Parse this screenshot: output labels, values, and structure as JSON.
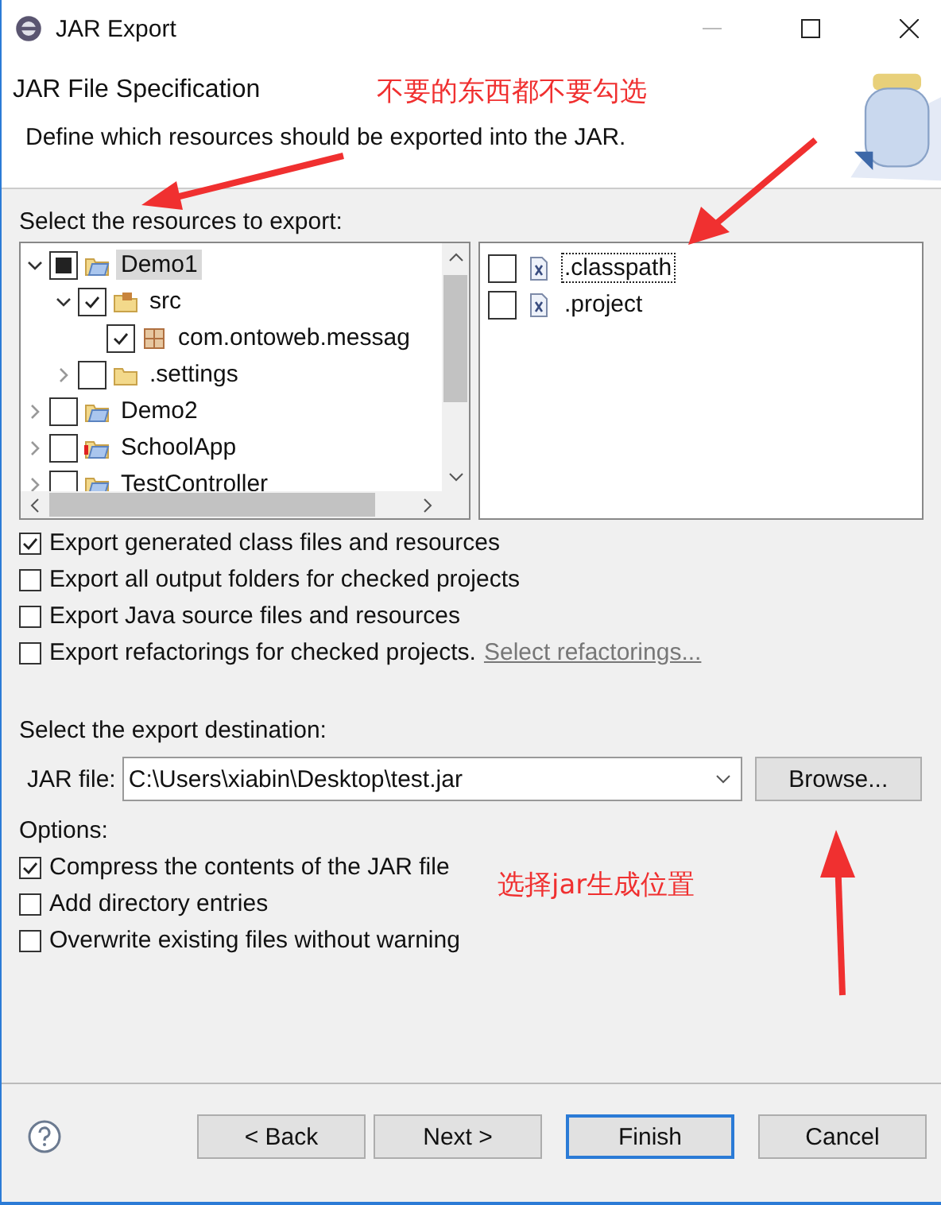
{
  "window": {
    "title": "JAR Export"
  },
  "header": {
    "title": "JAR File Specification",
    "description": "Define which resources should be exported into the JAR."
  },
  "annotations": [
    {
      "text": "不要的东西都不要勾选"
    },
    {
      "text": "选择jar生成位置"
    }
  ],
  "resources": {
    "label": "Select the resources to export:",
    "tree": [
      {
        "label": "Demo1",
        "kind": "project",
        "checked": true,
        "grayed": true,
        "expanded": true,
        "selected": true,
        "children": [
          {
            "label": "src",
            "kind": "source-folder",
            "checked": true,
            "expanded": true,
            "selected": false,
            "children": [
              {
                "label": "com.ontoweb.messag",
                "kind": "package",
                "checked": true,
                "selected": false
              }
            ]
          },
          {
            "label": ".settings",
            "kind": "folder",
            "checked": false,
            "expanded": false,
            "selected": false
          }
        ]
      },
      {
        "label": "Demo2",
        "kind": "project",
        "checked": false,
        "expanded": false,
        "selected": false
      },
      {
        "label": "SchoolApp",
        "kind": "project-error",
        "checked": false,
        "expanded": false,
        "selected": false
      },
      {
        "label": "TestController",
        "kind": "project",
        "checked": false,
        "expanded": false,
        "selected": false
      }
    ],
    "files": [
      {
        "label": ".classpath",
        "checked": false,
        "focused": true
      },
      {
        "label": ".project",
        "checked": false,
        "focused": false
      }
    ]
  },
  "export_options": [
    {
      "label": "Export generated class files and resources",
      "checked": true
    },
    {
      "label": "Export all output folders for checked projects",
      "checked": false
    },
    {
      "label": "Export Java source files and resources",
      "checked": false
    },
    {
      "label": "Export refactorings for checked projects.",
      "checked": false,
      "link": "Select refactorings..."
    }
  ],
  "destination": {
    "label": "Select the export destination:",
    "field_label": "JAR file:",
    "value": "C:\\Users\\xiabin\\Desktop\\test.jar",
    "browse": "Browse..."
  },
  "options": {
    "label": "Options:",
    "items": [
      {
        "label": "Compress the contents of the JAR file",
        "checked": true
      },
      {
        "label": "Add directory entries",
        "checked": false
      },
      {
        "label": "Overwrite existing files without warning",
        "checked": false
      }
    ]
  },
  "buttons": [
    {
      "label": "< Back",
      "default": false
    },
    {
      "label": "Next >",
      "default": false
    },
    {
      "label": "Finish",
      "default": true
    },
    {
      "label": "Cancel",
      "default": false
    }
  ]
}
